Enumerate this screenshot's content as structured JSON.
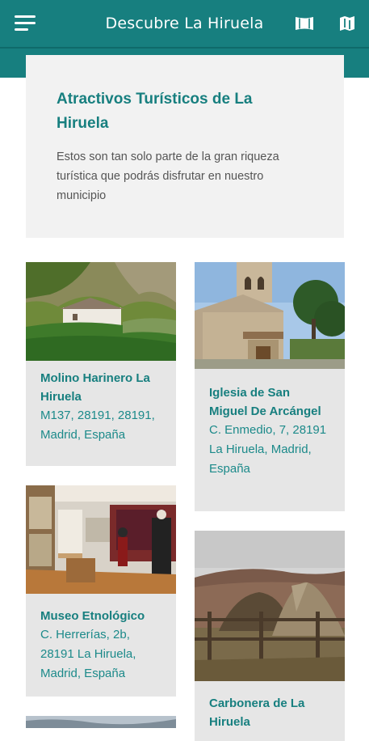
{
  "appbar": {
    "title": "Descubre La Hiruela",
    "menu_icon": "hamburger-menu-icon",
    "actions": [
      "panorama-icon",
      "map-icon"
    ],
    "background": "#177f7f"
  },
  "intro": {
    "title": "Atractivos Turísticos de La Hiruela",
    "description": "Estos son tan solo parte de la gran riqueza turística que podrás disfrutar en nuestro municipio"
  },
  "attractions": [
    {
      "name": "Molino Harinero La Hiruela",
      "address": "M137, 28191, 28191, Madrid, España"
    },
    {
      "name": "Iglesia de San Miguel De Arcángel",
      "address": "C. Enmedio, 7, 28191 La Hiruela, Madrid, España"
    },
    {
      "name": "Museo Etnológico",
      "address": "C. Herrerías, 2b, 28191 La Hiruela, Madrid, España"
    },
    {
      "name": "Carbonera de La Hiruela",
      "address": ""
    }
  ],
  "colors": {
    "accent": "#177f7f",
    "card_bg": "#e6e6e6",
    "intro_bg": "#f2f2f2"
  }
}
